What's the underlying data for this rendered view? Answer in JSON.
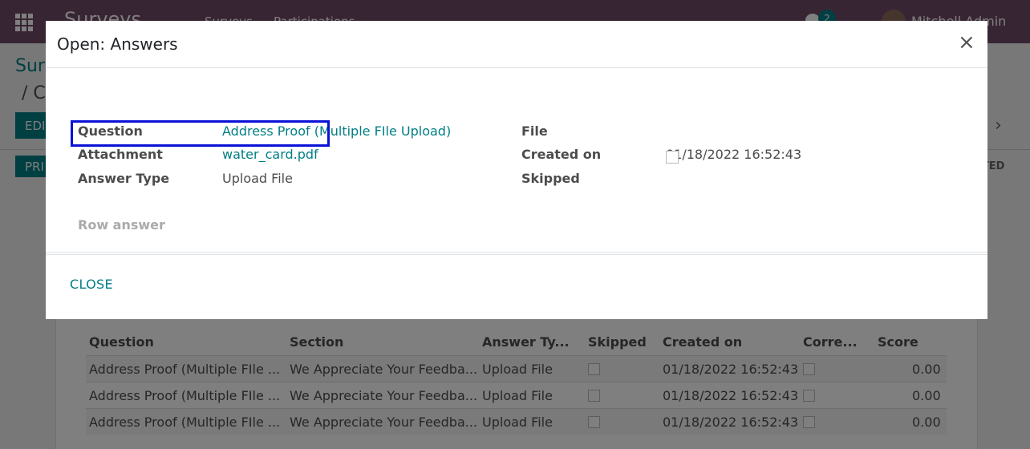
{
  "topbar": {
    "brand": "Surveys",
    "menu": [
      "Surveys",
      "Participations"
    ],
    "chat_count": "2",
    "user_name": "Mitchell Admin"
  },
  "page": {
    "breadcrumb_parent": "Sur",
    "breadcrumb_current": "/ C",
    "edit_label": "EDI",
    "print_label": "PRI",
    "state_label": "ETED"
  },
  "table": {
    "headers": [
      "Question",
      "Section",
      "Answer Ty...",
      "Skipped",
      "Created on",
      "Corre...",
      "Score"
    ],
    "rows": [
      {
        "question": "Address Proof (Multiple FIle ...",
        "section": "We Appreciate Your Feedba...",
        "answer_type": "Upload File",
        "created_on": "01/18/2022 16:52:43",
        "score": "0.00"
      },
      {
        "question": "Address Proof (Multiple FIle ...",
        "section": "We Appreciate Your Feedba...",
        "answer_type": "Upload File",
        "created_on": "01/18/2022 16:52:43",
        "score": "0.00"
      },
      {
        "question": "Address Proof (Multiple FIle ...",
        "section": "We Appreciate Your Feedba...",
        "answer_type": "Upload File",
        "created_on": "01/18/2022 16:52:43",
        "score": "0.00"
      }
    ]
  },
  "modal": {
    "title": "Open: Answers",
    "close_icon": "×",
    "labels": {
      "question": "Question",
      "attachment": "Attachment",
      "answer_type": "Answer Type",
      "row_answer": "Row answer",
      "file": "File",
      "created_on": "Created on",
      "skipped": "Skipped"
    },
    "values": {
      "question": "Address Proof (Multiple FIle Upload)",
      "attachment": "water_card.pdf",
      "answer_type": "Upload File",
      "created_on": "01/18/2022 16:52:43"
    },
    "close_button": "CLOSE"
  },
  "colors": {
    "brand": "#714b67",
    "accent": "#017e84",
    "highlight": "#0a12d6"
  }
}
